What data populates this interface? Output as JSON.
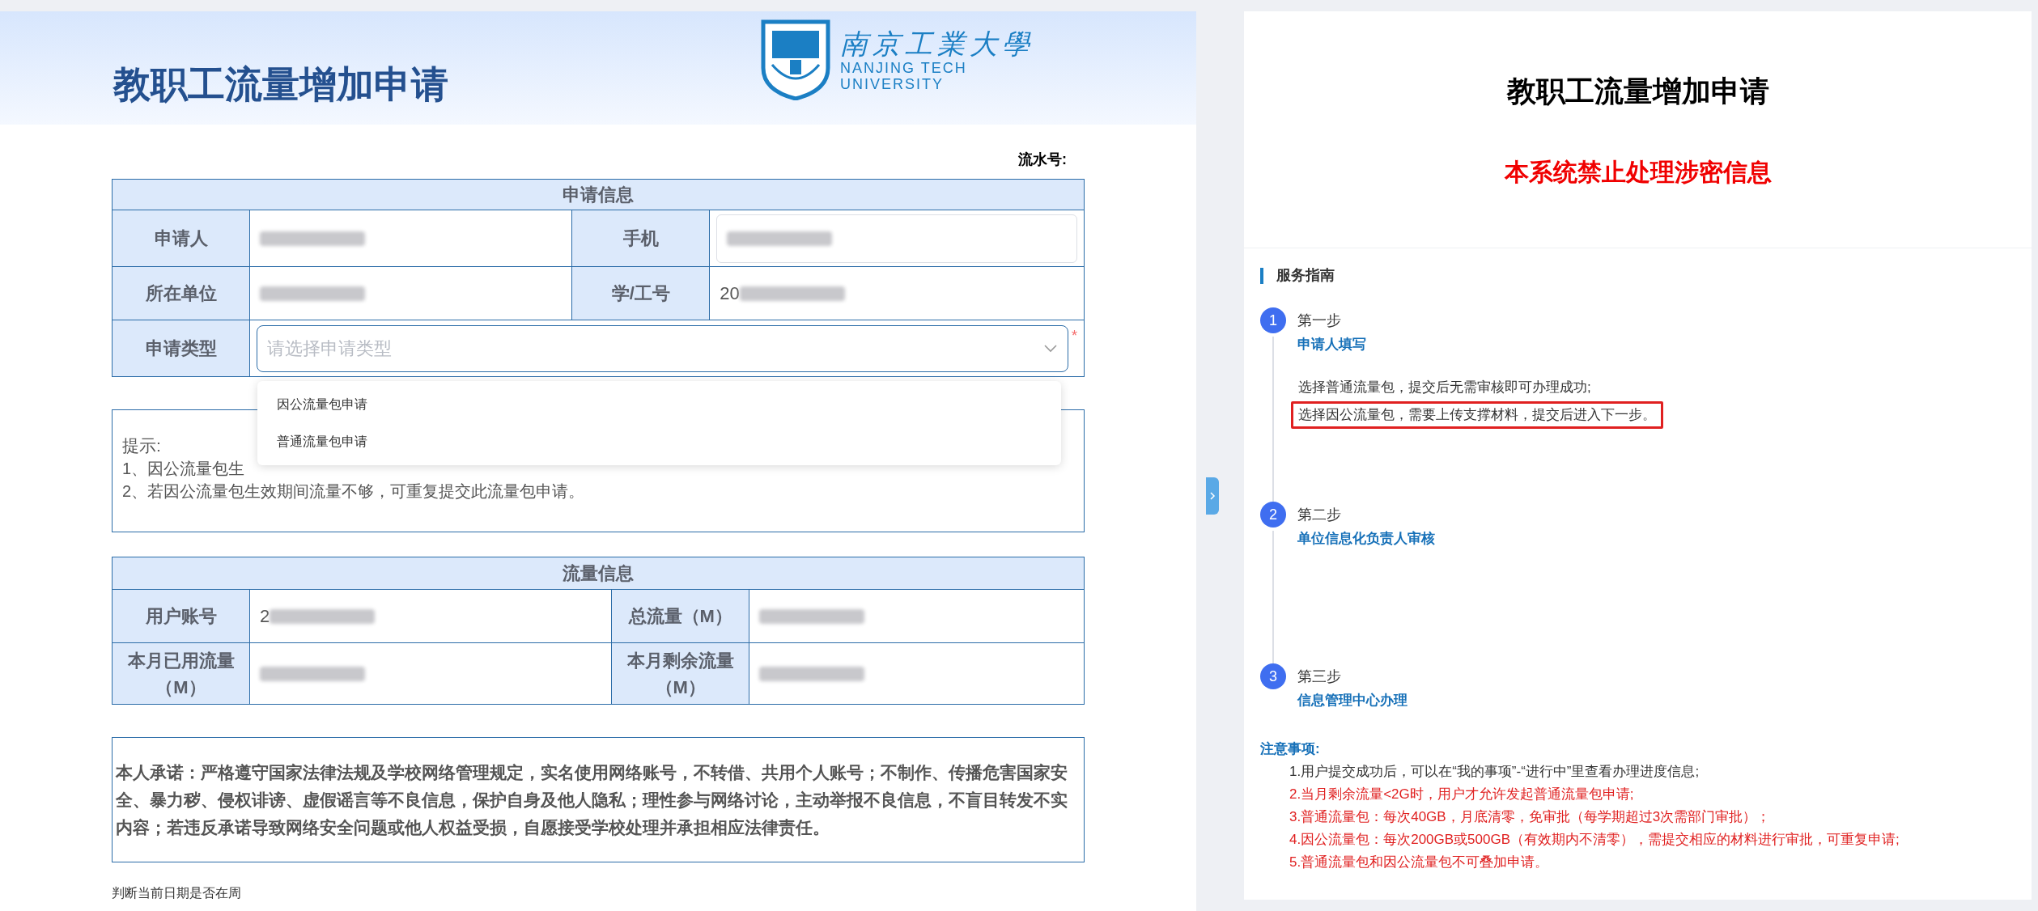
{
  "form": {
    "title": "教职工流量增加申请",
    "logo": {
      "name_cn": "南京工業大學",
      "name_en_1": "NANJING TECH",
      "name_en_2": "UNIVERSITY"
    },
    "serial_label": "流水号:",
    "apply_section": {
      "header": "申请信息",
      "rows": [
        {
          "label": "申请人",
          "kind": "text"
        },
        {
          "label": "手机",
          "kind": "input"
        }
      ],
      "row2": [
        {
          "label": "所在单位",
          "kind": "text"
        },
        {
          "label": "学/工号",
          "value": "20",
          "kind": "text"
        }
      ],
      "type_row": {
        "label": "申请类型",
        "placeholder": "请选择申请类型",
        "required_mark": "*",
        "expanded": true,
        "options": [
          {
            "label": "因公流量包申请",
            "selected": false
          },
          {
            "label": "普通流量包申请",
            "selected": false
          }
        ]
      }
    },
    "hint": {
      "title": "提示:",
      "lines": [
        "1、因公流量包生",
        "2、若因公流量包生效期间流量不够，可重复提交此流量包申请。"
      ]
    },
    "traffic_section": {
      "header": "流量信息",
      "rows": [
        [
          {
            "label": "用户账号",
            "value": "2",
            "kind": "text"
          },
          {
            "label": "总流量（M）",
            "kind": "text"
          }
        ],
        [
          {
            "label": "本月已用流量（M）",
            "kind": "text"
          },
          {
            "label": "本月剩余流量（M）",
            "kind": "text"
          }
        ]
      ]
    },
    "pledge": "本人承诺：严格遵守国家法律法规及学校网络管理规定，实名使用网络账号，不转借、共用个人账号；不制作、传播危害国家安全、暴力秽、侵权诽谤、虚假谣言等不良信息，保护自身及他人隐私；理性参与网络讨论，主动举报不良信息，不盲目转发不实内容；若违反承诺导致网络安全问题或他人权益受损，自愿接受学校处理并承担相应法律责任。",
    "footer_text": "判断当前日期是否在周"
  },
  "guide": {
    "title": "教职工流量增加申请",
    "warning": "本系统禁止处理涉密信息",
    "section_title": "服务指南",
    "steps": [
      {
        "number": "1",
        "label": "第一步",
        "name": "申请人填写",
        "lines": [
          {
            "text": "选择普通流量包，提交后无需审核即可办理成功;",
            "highlighted": false
          },
          {
            "text": "选择因公流量包，需要上传支撑材料，提交后进入下一步。",
            "highlighted": true
          }
        ]
      },
      {
        "number": "2",
        "label": "第二步",
        "name": "单位信息化负责人审核"
      },
      {
        "number": "3",
        "label": "第三步",
        "name": "信息管理中心办理"
      }
    ],
    "notes_title": "注意事项:",
    "notes": [
      {
        "text": "1.用户提交成功后，可以在“我的事项”-“进行中”里查看办理进度信息;",
        "color": "#333333"
      },
      {
        "text": "2.当月剩余流量<2G时，用户才允许发起普通流量包申请;",
        "color": "#e02020"
      },
      {
        "text": "3.普通流量包：每次40GB，月底清零，免审批（每学期超过3次需部门审批）；",
        "color": "#e02020"
      },
      {
        "text": "4.因公流量包：每次200GB或500GB（有效期内不清零），需提交相应的材料进行审批，可重复申请;",
        "color": "#e02020"
      },
      {
        "text": "5.普通流量包和因公流量包不可叠加申请。",
        "color": "#e02020"
      }
    ]
  }
}
